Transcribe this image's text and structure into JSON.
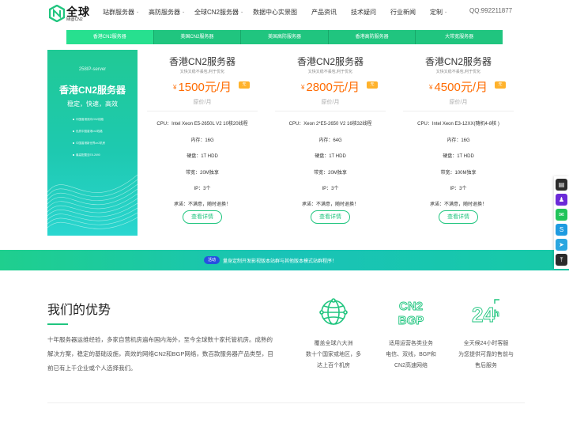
{
  "header": {
    "brand": "全球",
    "brand_sub": "Mt@CN2",
    "nav": [
      {
        "label": "站群服务器",
        "dropdown": true
      },
      {
        "label": "高防服务器",
        "dropdown": true
      },
      {
        "label": "全球CN2服务器",
        "dropdown": true
      },
      {
        "label": "数据中心实景图",
        "dropdown": false
      },
      {
        "label": "产品资讯",
        "dropdown": false
      },
      {
        "label": "技术疑问",
        "dropdown": false
      },
      {
        "label": "行业新闻",
        "dropdown": false
      },
      {
        "label": "定制",
        "dropdown": true
      }
    ],
    "phone": "QQ:992211877"
  },
  "tabs": [
    {
      "label": "香港CN2服务器",
      "active": true
    },
    {
      "label": "美国CN2服务器",
      "active": false
    },
    {
      "label": "美国高防服务器",
      "active": false
    },
    {
      "label": "香港高防服务器",
      "active": false
    },
    {
      "label": "大带宽服务器",
      "active": false
    }
  ],
  "banner": {
    "tag": "258IP-server",
    "title": "香港CN2服务器",
    "subtitle": "稳定，快速，高效",
    "bullets": [
      "中国香港双向CN2线路",
      "优质中国香港cn2线路",
      "中国香港新世界cn2机房",
      "最高配置至E5-2690"
    ]
  },
  "products": [
    {
      "name": "香港CN2服务器",
      "desc": "又快又稳不丢包,利于优化",
      "currency": "¥",
      "price": "1500元/月",
      "badge": "无",
      "orig": "原价/月",
      "specs": [
        "CPU：Intel Xeon E5-2650L V2 10核20线程",
        "内存：16G",
        "硬盘：1T HDD",
        "带宽：20M独享",
        "IP：3个",
        "承诺：不满意，随时退换！"
      ],
      "cta": "查看详情"
    },
    {
      "name": "香港CN2服务器",
      "desc": "又快又稳不丢包,利于优化",
      "currency": "¥",
      "price": "2800元/月",
      "badge": "无",
      "orig": "原价/月",
      "specs": [
        "CPU：Xeon 2*E5-2650 V2 16核32线程",
        "内存：64G",
        "硬盘：1T HDD",
        "带宽：20M独享",
        "IP：3个",
        "承诺：不满意，随时退换！"
      ],
      "cta": "查看详情"
    },
    {
      "name": "香港CN2服务器",
      "desc": "又快又稳不丢包,利于优化",
      "currency": "¥",
      "price": "4500元/月",
      "badge": "无",
      "orig": "原价/月",
      "specs": [
        "CPU：Intel Xeon E3-12XX(随机4-8核 )",
        "内存：16G",
        "硬盘：1T HDD",
        "带宽：100M独享",
        "IP：3个",
        "承诺：不满意，随时退换！"
      ],
      "cta": "查看详情"
    }
  ],
  "promo": {
    "pill": "活动",
    "text": "量身定制开发影视版本站群与其他版本模式站群程序！"
  },
  "advantages": {
    "title": "我们的优势",
    "text": "十年服务器运维经验，多家自营机房遍布国内海外，至今全球数十家托管机房。成熟的解决方案，稳定的基础设施，高效的网络CN2和BGP网络，数百款服务器产品类型，目前已有上千企业或个人选择我们。",
    "features": [
      {
        "icon": "globe-icon",
        "lines": [
          "覆盖全球六大洲",
          "数十个国家或地区，多",
          "达上百个机房"
        ]
      },
      {
        "icon": "cn2-bgp-icon",
        "icon_text": [
          "CN2",
          "BGP"
        ],
        "lines": [
          "适用运营各类业务",
          "电信、双线，BGP和",
          "CN2高速网络"
        ]
      },
      {
        "icon": "24h-icon",
        "icon_text": [
          "24",
          "h"
        ],
        "lines": [
          "全天候24小时客服",
          "为您提供可靠的售前与",
          "售后服务"
        ]
      }
    ]
  },
  "colors": {
    "accent": "#20c57f",
    "price": "#ff6b00",
    "badge": "#ffb22b",
    "pill": "#2750e0"
  }
}
